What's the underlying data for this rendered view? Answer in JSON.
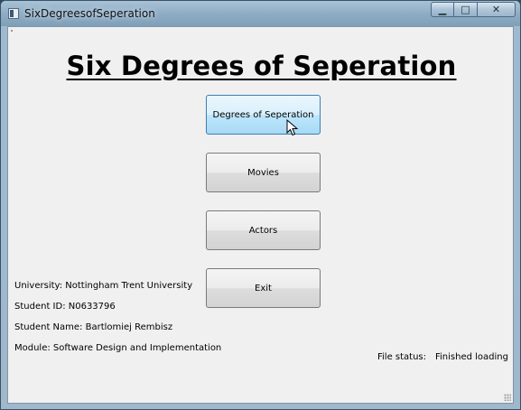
{
  "window": {
    "title": "SixDegreesofSeperation",
    "controls": {
      "minimize": "▁",
      "maximize": "□",
      "close": "✕"
    }
  },
  "main": {
    "heading": "Six Degrees of Seperation",
    "buttons": [
      {
        "label": "Degrees of Seperation",
        "state": "hover"
      },
      {
        "label": "Movies"
      },
      {
        "label": "Actors"
      },
      {
        "label": "Exit"
      }
    ]
  },
  "info": {
    "university": "University: Nottingham Trent University",
    "student_id": "Student ID: N0633796",
    "student_name": "Student Name: Bartlomiej Rembisz",
    "module": "Module: Software Design and Implementation"
  },
  "status": {
    "label": "File status:",
    "value": "Finished loading"
  },
  "colors": {
    "hover_button": "#bee6fd",
    "button_face": "#e6e6e6",
    "client_bg": "#f0f0f0"
  }
}
